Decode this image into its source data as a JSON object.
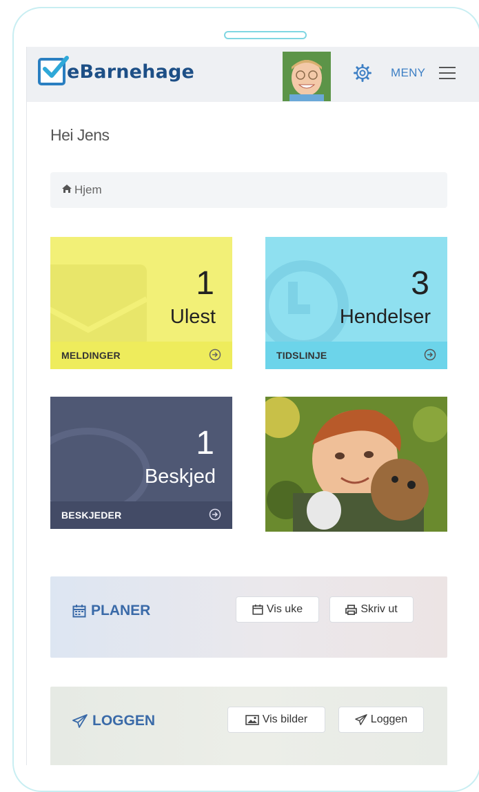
{
  "header": {
    "brand": "eBarnehage",
    "menu_label": "MENY"
  },
  "greeting": "Hei Jens",
  "breadcrumb": {
    "home": "Hjem"
  },
  "tiles": [
    {
      "number": "1",
      "label": "Ulest",
      "footer": "MELDINGER",
      "color": "#f2f077"
    },
    {
      "number": "3",
      "label": "Hendelser",
      "footer": "TIDSLINJE",
      "color": "#8fe0f0"
    },
    {
      "number": "1",
      "label": "Beskjed",
      "footer": "BESKJEDER",
      "color": "#4f5874"
    }
  ],
  "panels": {
    "planer": {
      "title": "PLANER",
      "btn1": "Vis uke",
      "btn2": "Skriv ut"
    },
    "loggen": {
      "title": "LOGGEN",
      "btn1": "Vis bilder",
      "btn2": "Loggen"
    }
  },
  "colors": {
    "accent": "#3a6aa8",
    "brand": "#1d4f86"
  },
  "icons": [
    "home-icon",
    "gear-icon",
    "hamburger-icon",
    "arrow-circle-icon",
    "calendar-icon",
    "print-icon",
    "image-icon",
    "paper-plane-icon"
  ]
}
